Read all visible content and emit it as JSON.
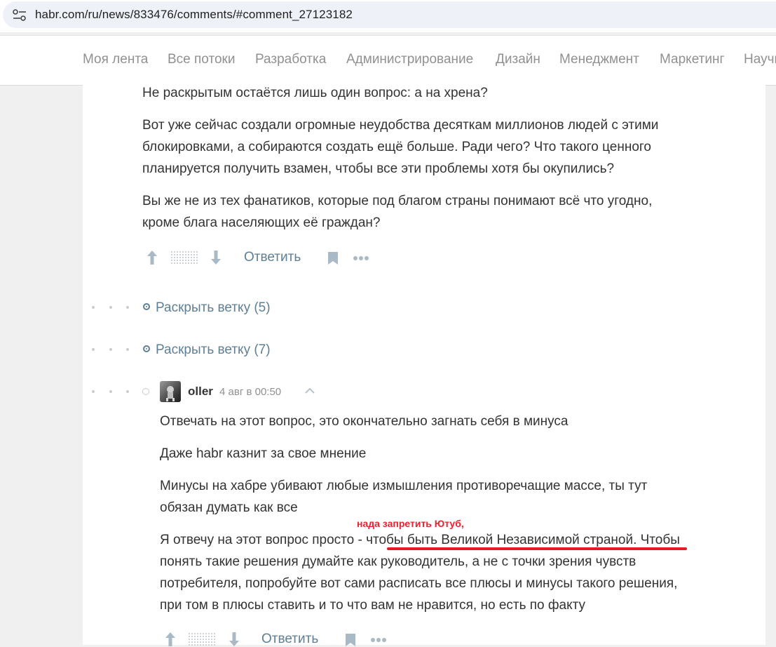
{
  "browser": {
    "url": "habr.com/ru/news/833476/comments/#comment_27123182",
    "site_info_icon": "site-settings-icon"
  },
  "nav": {
    "items": [
      "Моя лента",
      "Все потоки",
      "Разработка",
      "Администрирование",
      "Дизайн",
      "Менеджмент",
      "Маркетинг",
      "Научпоп"
    ]
  },
  "comment1": {
    "paragraphs": [
      [
        "Не раскрытым остаётся лишь один вопрос: а на хрена?"
      ],
      [
        "Вот уже сейчас создали огромные неудобства десяткам миллионов людей с этими",
        "блокировками, а собираются создать ещё больше. Ради чего? Что такого ценного",
        "планируется получить взамен, чтобы все эти проблемы хотя бы окупились?"
      ],
      [
        "Вы же не из тех фанатиков, которые под благом страны понимают всё что угодно,",
        "кроме блага населяющих её граждан?"
      ]
    ],
    "reply_label": "Ответить"
  },
  "threads": [
    {
      "label": "Раскрыть ветку (5)"
    },
    {
      "label": "Раскрыть ветку (7)"
    }
  ],
  "comment2": {
    "author": "oller",
    "time": "4 авг в 00:50",
    "paragraphs": [
      "Отвечать на этот вопрос, это окончательно загнать себя в минуса",
      "Даже habr казнит за свое мнение",
      "Минусы на хабре убивают любые измышления противоречащие массе, ты тут",
      "обязан думать как все"
    ],
    "last_paragraph": {
      "prefix": "Я отвечу на этот вопрос просто - ",
      "highlight": "чтобы быть Великой Независимой страной",
      "suffix": ". Чтобы",
      "lines": [
        "понять такие решения думайте как руководитель, а не с точки зрения чувств",
        "потребителя, попробуйте вот сами расписать все плюсы и минусы такого решения,",
        "при том в плюсы ставить и то что вам не нравится, но есть по факту"
      ]
    },
    "annotation": "нада запретить Ютуб,",
    "reply_label": "Ответить"
  },
  "colors": {
    "accent": "#5e7f96",
    "annotation_red": "#e41b23",
    "text": "#333333",
    "muted": "#909090"
  }
}
